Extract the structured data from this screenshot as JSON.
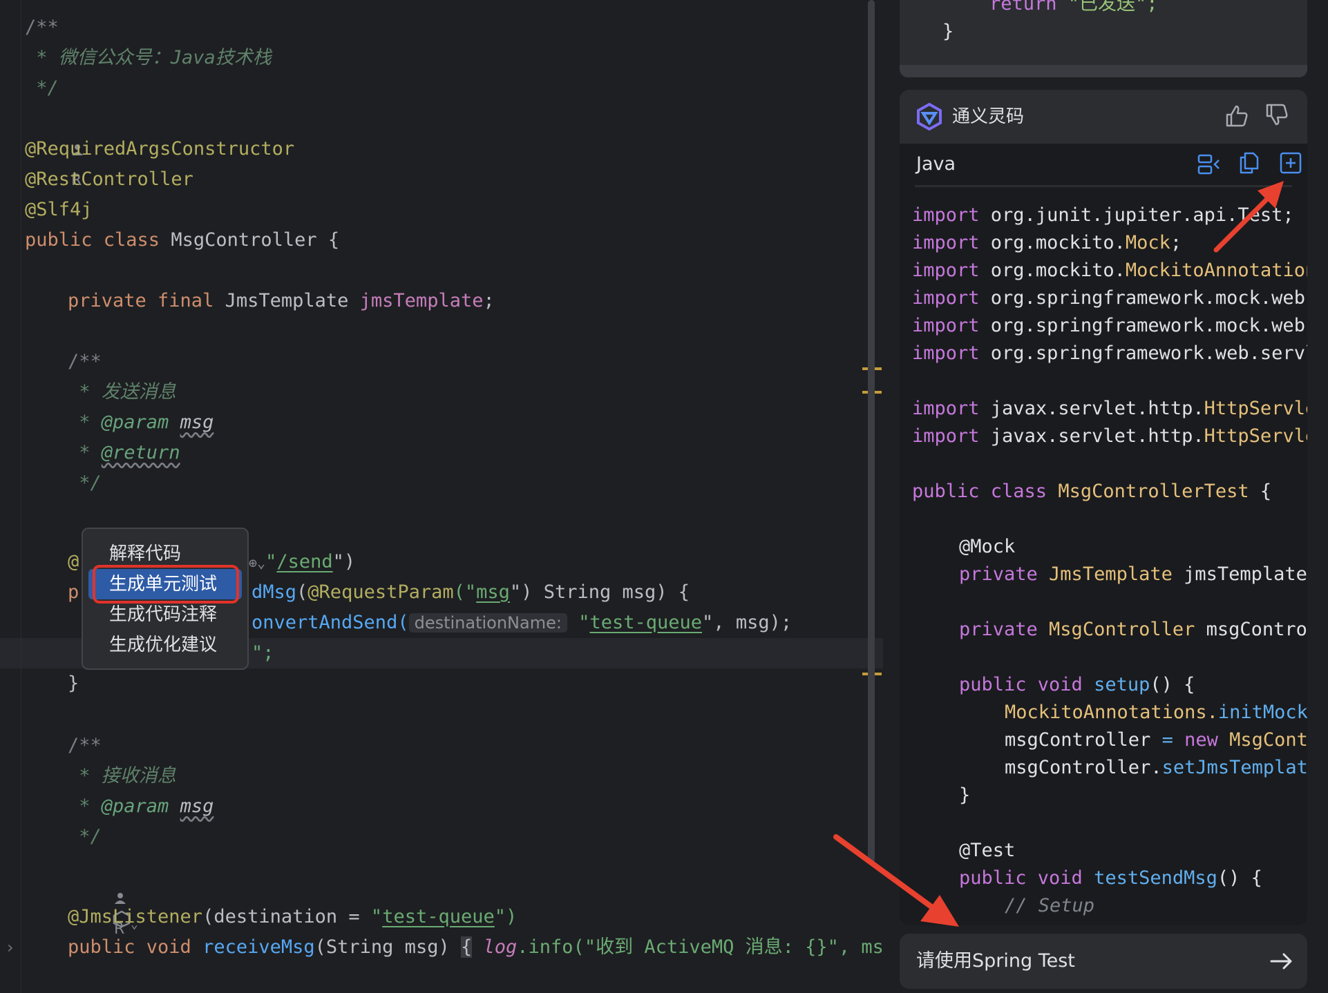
{
  "editor": {
    "lines": {
      "l1": "/**",
      "l2": " * 微信公众号：Java技术栈",
      "l3": " */",
      "author": "R",
      "a1": "@RequiredArgsConstructor",
      "a2": "@RestController",
      "a3": "@Slf4j",
      "class_kw": "public class ",
      "class_name": "MsgController {",
      "field_kw": "private final ",
      "field_type": "JmsTemplate ",
      "field_name": "jmsTemplate",
      "semicolon": ";",
      "doc_open": "/**",
      "doc_send": " * 发送消息",
      "param_star": " * ",
      "param_tag": "@param",
      "param_name": "msg",
      "return_star": " * ",
      "return_tag": "@return",
      "doc_close": " */",
      "mapping_frag_a": "@",
      "mapping_frag_b": "\"",
      "mapping_path": "/send",
      "mapping_end": "\")",
      "method_frag": "p",
      "method_name_tail": "dMsg",
      "method_params_a": "(",
      "reqparam": "@RequestParam",
      "reqparam_open": "(\"",
      "reqparam_val": "msg",
      "reqparam_close": "\") String msg) {",
      "send_call": "onvertAndSend(",
      "hint_dest": "destinationName:",
      "queue_q1": "\"",
      "queue_name": "test-queue",
      "send_end": "\", msg);",
      "return_tail": "\";",
      "close_brace": "}",
      "doc_recv": " * 接收消息",
      "listener_ann": "@JmsListener",
      "listener_args_a": "(destination = ",
      "listener_q": "\"",
      "listener_queue": "test-queue",
      "listener_end": "\")",
      "recv_kw": "public void ",
      "recv_name": "receiveMsg",
      "recv_params": "(String msg) ",
      "recv_brace": "{",
      "recv_log": "log",
      "recv_info": ".info(\"收到 ActiveMQ 消息: {}\", msg);"
    }
  },
  "context_menu": {
    "items": [
      "解释代码",
      "生成单元测试",
      "生成代码注释",
      "生成优化建议"
    ],
    "selected": "生成单元测试"
  },
  "right_panel": {
    "prev_return_kw": "return ",
    "prev_return_str": "\"已发送\";",
    "prev_brace": "}",
    "chat_title": "通义灵码",
    "code_lang": "Java",
    "code": {
      "imp": "import ",
      "i1": "org.junit.jupiter.api.Test;",
      "i2a": "org.mockito.",
      "i2b": "Mock",
      "i2c": ";",
      "i3a": "org.mockito.",
      "i3b": "MockitoAnnotations;",
      "i4": "org.springframework.mock.web.MockHttpServletRequest;",
      "i5": "org.springframework.mock.web.MockHttpServletResponse;",
      "i6": "org.springframework.web.servlet.ModelAndView;",
      "i7a": "javax.servlet.http.",
      "i7b": "HttpServletRequest;",
      "i8a": "javax.servlet.http.",
      "i8b": "HttpServletResponse;",
      "cls_kw": "public class ",
      "cls_name": "MsgControllerTest",
      "cls_brace": " {",
      "mock_ann": "@Mock",
      "priv": "private ",
      "jms_type": "JmsTemplate",
      "jms_name": " jmsTemplate;",
      "ctl_type": "MsgController",
      "ctl_name": " msgController;",
      "pv": "public void ",
      "setup": "setup",
      "setup_end": "() {",
      "mock_init_a": "MockitoAnnotations.",
      "mock_init_b": "initMocks(this);",
      "assign_a": "msgController ",
      "assign_eq": "= ",
      "assign_new": "new ",
      "assign_cls": "MsgController();",
      "set_a": "msgController.",
      "set_b": "setJmsTemplate(jmsTemplate);",
      "close": "}",
      "test_ann": "@Test",
      "test_name": "testSendMsg",
      "test_end": "() {",
      "comment": "// Setup"
    },
    "input_text": "请使用Spring Test"
  }
}
